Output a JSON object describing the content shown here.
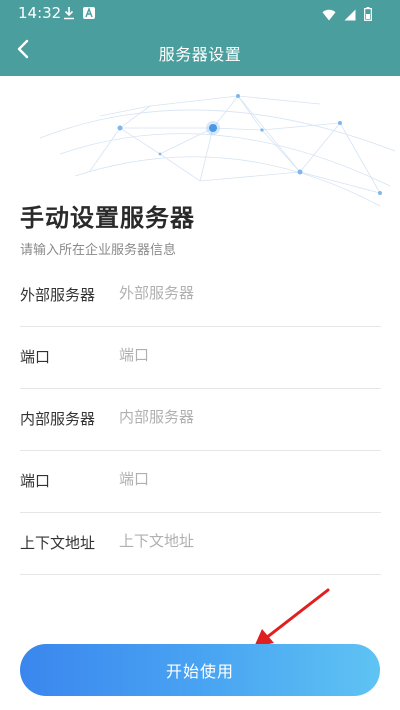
{
  "status_bar": {
    "time": "14:32",
    "left_icons": [
      "download-icon",
      "a-notification-icon"
    ],
    "right_icons": [
      "wifi-icon",
      "signal-icon",
      "battery-icon"
    ]
  },
  "title_bar": {
    "title": "服务器设置",
    "back_icon": "chevron-left-icon",
    "background_color": "#4a9e9d"
  },
  "header": {
    "heading": "手动设置服务器",
    "subheading": "请输入所在企业服务器信息"
  },
  "form": {
    "fields": [
      {
        "label": "外部服务器",
        "value": "",
        "placeholder": "外部服务器"
      },
      {
        "label": "端口",
        "value": "",
        "placeholder": "端口"
      },
      {
        "label": "内部服务器",
        "value": "",
        "placeholder": "内部服务器"
      },
      {
        "label": "端口",
        "value": "",
        "placeholder": "端口"
      },
      {
        "label": "上下文地址",
        "value": "",
        "placeholder": "上下文地址"
      }
    ]
  },
  "action": {
    "start_label": "开始使用",
    "gradient_start": "#3a86ee",
    "gradient_end": "#5fc3f3"
  },
  "annotation": {
    "arrow_color": "#e02020"
  }
}
